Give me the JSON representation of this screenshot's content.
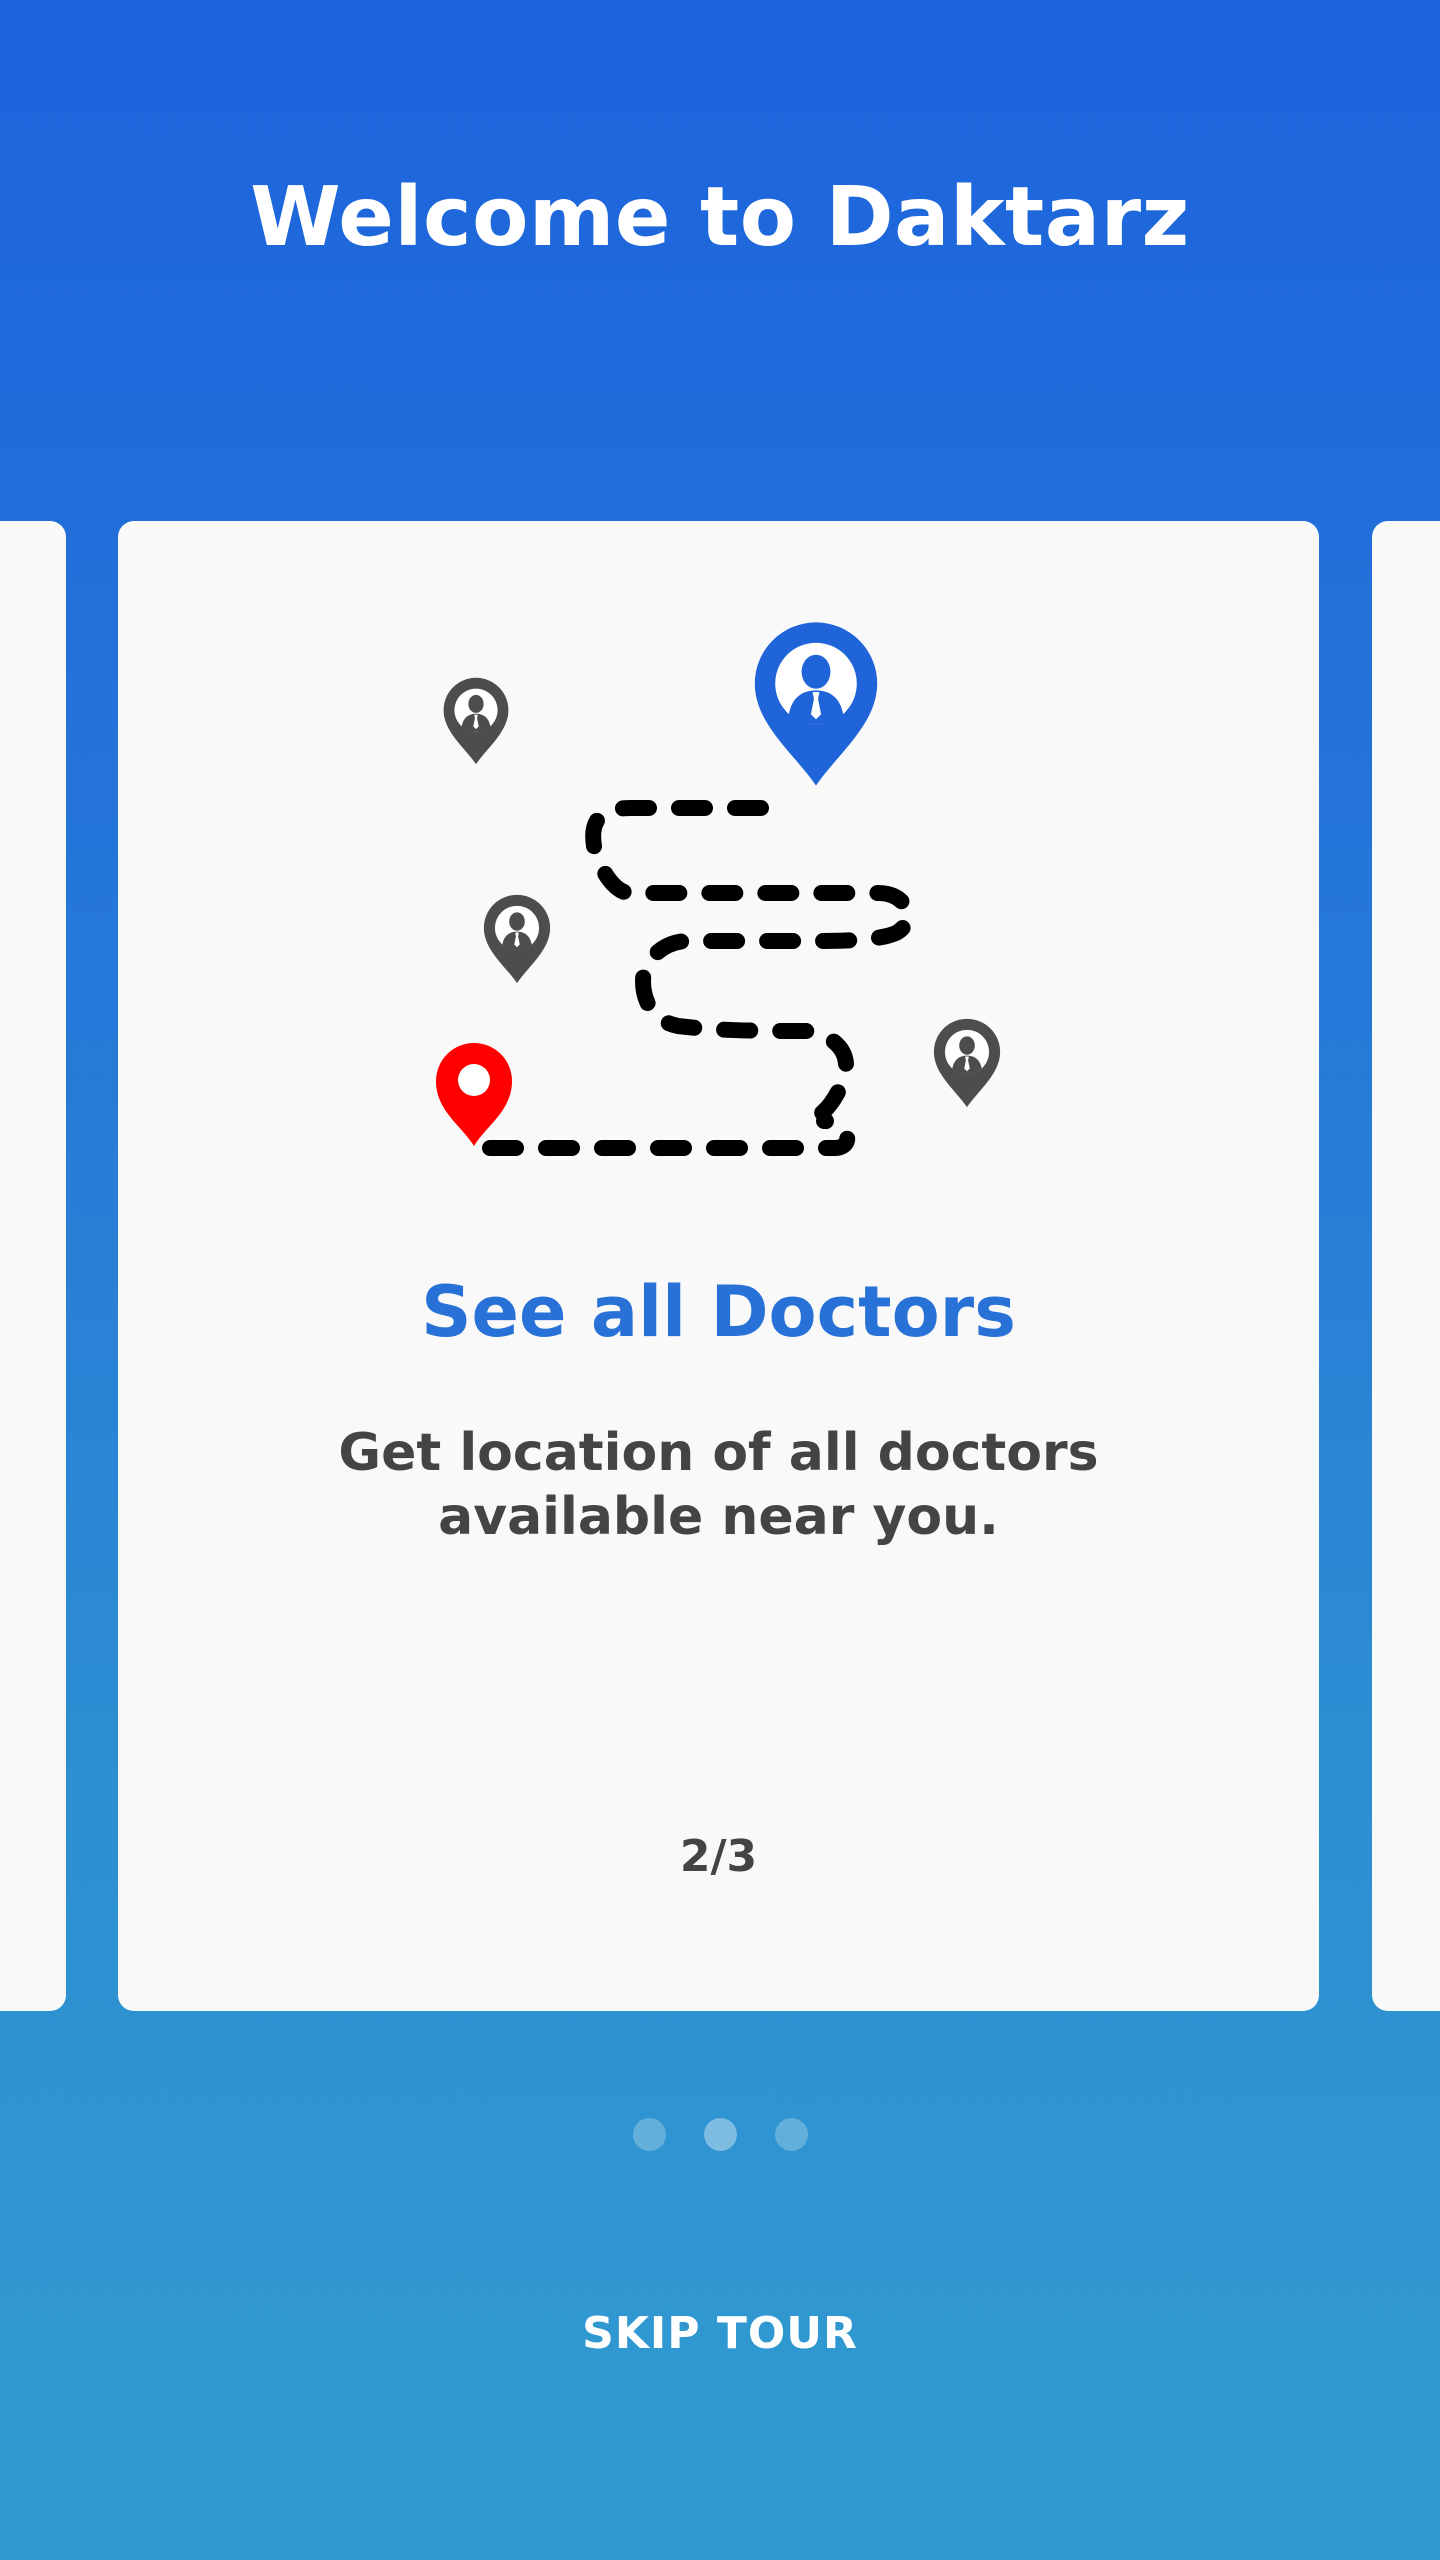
{
  "header": {
    "title": "Welcome to Daktarz"
  },
  "slide": {
    "title": "See all Doctors",
    "description": "Get location of all doctors available near you.",
    "page_indicator": "2/3",
    "illustration_icons": [
      "doctor-location-pin-icon",
      "user-location-pin-icon",
      "dashed-route-icon"
    ]
  },
  "pagination": {
    "total": 3,
    "active_index": 1
  },
  "footer": {
    "skip_label": "SKIP TOUR"
  },
  "colors": {
    "primary_blue": "#1c63dd",
    "accent_blue": "#2771d7",
    "user_pin_red": "#ff0000",
    "doctor_pin_gray": "#4d4d4d",
    "card_bg": "#f9f9f9"
  }
}
